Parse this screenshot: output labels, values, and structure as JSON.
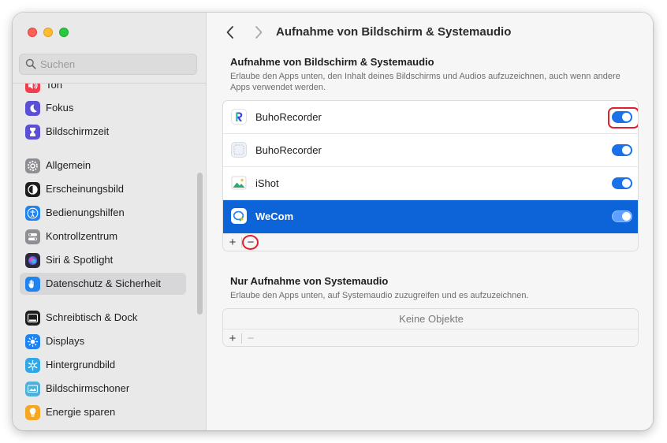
{
  "sidebar": {
    "search_placeholder": "Suchen",
    "items": [
      {
        "label": "Ton",
        "icon": "speaker-icon",
        "color": "#f23d4f"
      },
      {
        "label": "Fokus",
        "icon": "moon-icon",
        "color": "#5b4fd6"
      },
      {
        "label": "Bildschirmzeit",
        "icon": "hourglass-icon",
        "color": "#5b4fd6"
      },
      {
        "label": "Allgemein",
        "icon": "gear-icon",
        "color": "#8e8e93"
      },
      {
        "label": "Erscheinungsbild",
        "icon": "appearance-icon",
        "color": "#1e1e1e"
      },
      {
        "label": "Bedienungshilfen",
        "icon": "accessibility-icon",
        "color": "#1f84f0"
      },
      {
        "label": "Kontrollzentrum",
        "icon": "control-center-icon",
        "color": "#8e8e93"
      },
      {
        "label": "Siri & Spotlight",
        "icon": "siri-icon",
        "color": "#2a2a3a"
      },
      {
        "label": "Datenschutz & Sicherheit",
        "icon": "hand-icon",
        "color": "#1f84f0",
        "selected": true
      },
      {
        "label": "Schreibtisch & Dock",
        "icon": "dock-icon",
        "color": "#1e1e1e"
      },
      {
        "label": "Displays",
        "icon": "sun-icon",
        "color": "#1f84f0"
      },
      {
        "label": "Hintergrundbild",
        "icon": "snowflake-icon",
        "color": "#2fa8e6"
      },
      {
        "label": "Bildschirmschoner",
        "icon": "screensaver-icon",
        "color": "#4fb0d8"
      },
      {
        "label": "Energie sparen",
        "icon": "battery-icon",
        "color": "#f5a623"
      }
    ]
  },
  "header": {
    "title": "Aufnahme von Bildschirm & Systemaudio"
  },
  "screen_section": {
    "title": "Aufnahme von Bildschirm & Systemaudio",
    "description": "Erlaube den Apps unten, den Inhalt deines Bildschirms und Audios aufzuzeichnen, auch wenn andere Apps verwendet werden.",
    "apps": [
      {
        "name": "BuhoRecorder",
        "enabled": true,
        "icon": "buhorecorder-icon"
      },
      {
        "name": "BuhoRecorder",
        "enabled": true,
        "icon": "buhorecorder-placeholder-icon"
      },
      {
        "name": "iShot",
        "enabled": true,
        "icon": "ishot-icon"
      },
      {
        "name": "WeCom",
        "enabled": true,
        "icon": "wecom-icon",
        "selected": true
      }
    ],
    "add_label": "+",
    "remove_label": "−"
  },
  "audio_section": {
    "title": "Nur Aufnahme von Systemaudio",
    "description": "Erlaube den Apps unten, auf Systemaudio zuzugreifen und es aufzuzeichnen.",
    "empty_text": "Keine Objekte",
    "add_label": "+",
    "remove_label": "−"
  },
  "colors": {
    "accent": "#1b72e8",
    "selection": "#0d64d8",
    "highlight": "#e0202c"
  }
}
